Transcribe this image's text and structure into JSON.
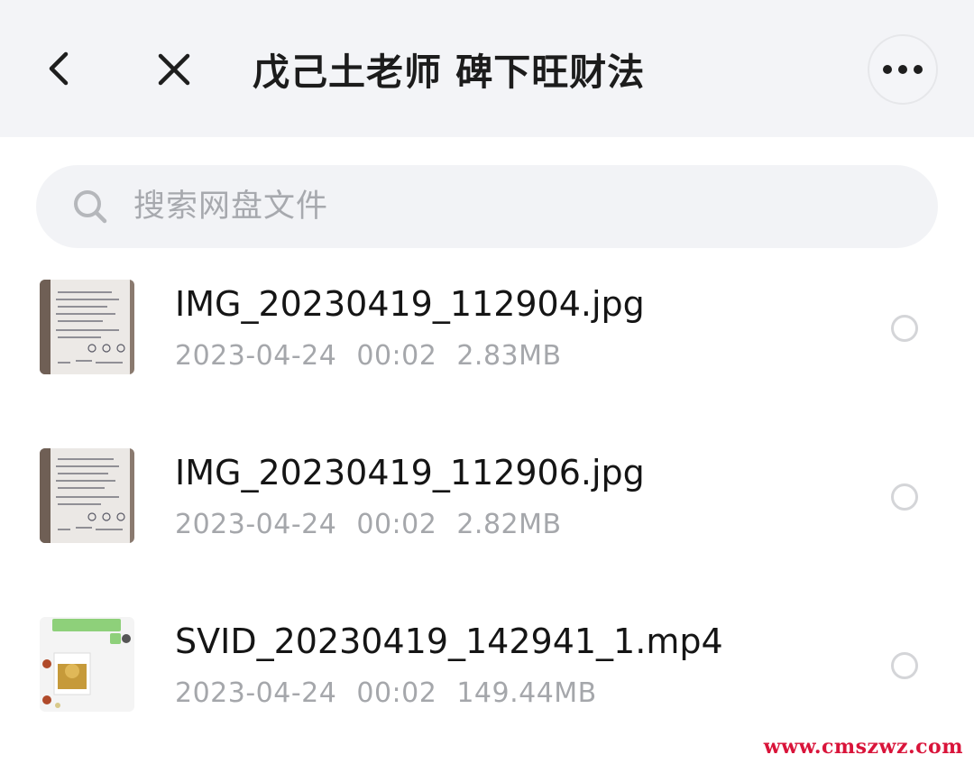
{
  "header": {
    "title": "戊己土老师 碑下旺财法",
    "back_icon": "back-arrow-icon",
    "close_icon": "close-icon",
    "more_icon": "more-horizontal-icon"
  },
  "search": {
    "placeholder": "搜索网盘文件",
    "icon": "search-icon"
  },
  "files": [
    {
      "name": "IMG_20230419_112904.jpg",
      "date": "2023-04-24",
      "time": "00:02",
      "size": "2.83MB",
      "thumbnail": "handwritten-notes-photo"
    },
    {
      "name": "IMG_20230419_112906.jpg",
      "date": "2023-04-24",
      "time": "00:02",
      "size": "2.82MB",
      "thumbnail": "handwritten-notes-photo"
    },
    {
      "name": "SVID_20230419_142941_1.mp4",
      "date": "2023-04-24",
      "time": "00:02",
      "size": "149.44MB",
      "thumbnail": "chat-screenshot-video"
    }
  ],
  "watermark": "www.cmszwz.com",
  "colors": {
    "header_bg": "#f3f4f7",
    "title": "#1c1c1c",
    "meta": "#a5a7ab",
    "watermark": "#d9143a"
  }
}
